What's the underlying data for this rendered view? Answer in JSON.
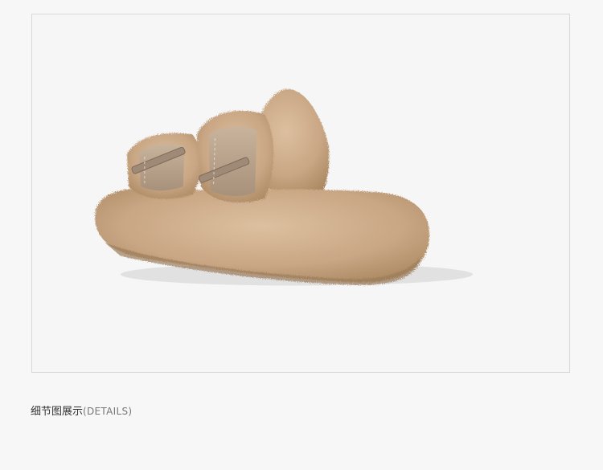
{
  "section": {
    "title": "细节图展示",
    "subtitle": "(DETAILS)"
  },
  "product_image": {
    "subject": "slipper-photo",
    "colors": {
      "fur": "#c7a583",
      "fur_dark": "#a88664",
      "fur_light": "#e0c6a8",
      "strap": "#b8a28c",
      "buckle": "#9e8a76"
    }
  }
}
